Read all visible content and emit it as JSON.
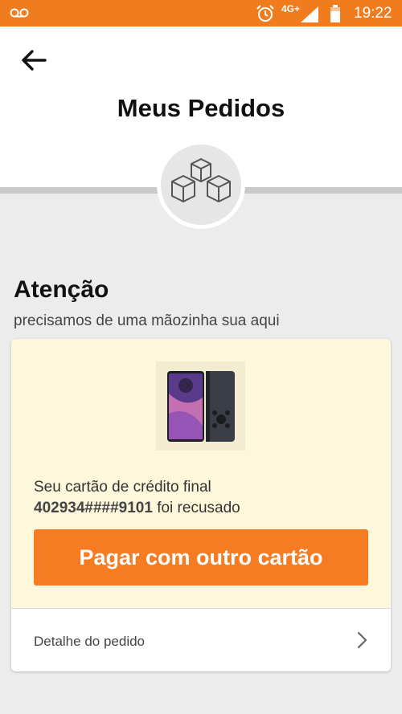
{
  "status_bar": {
    "network": "4G+",
    "time": "19:22"
  },
  "header": {
    "title": "Meus Pedidos"
  },
  "attention": {
    "title": "Atenção",
    "subtitle": "precisamos de uma mãozinha sua aqui"
  },
  "order_card": {
    "message_prefix": "Seu cartão de crédito final",
    "card_number": "402934####9101",
    "message_suffix": " foi recusado",
    "pay_button_label": "Pagar com outro cartão",
    "detail_label": "Detalhe do pedido"
  },
  "colors": {
    "brand_orange": "#f57c22",
    "status_bar": "#f07c1d",
    "card_highlight": "#fdf8db"
  }
}
